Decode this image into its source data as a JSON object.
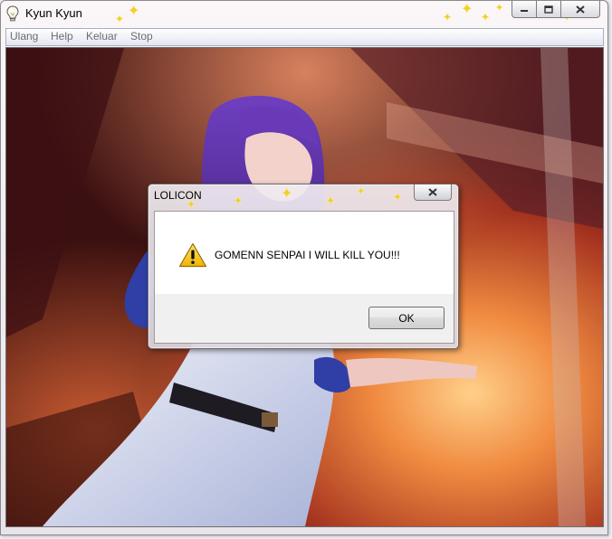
{
  "window": {
    "title": "Kyun Kyun",
    "icon": "lightbulb-icon",
    "controls": [
      "minimize-icon",
      "maximize-icon",
      "close-icon"
    ]
  },
  "menu": {
    "items": [
      {
        "label": "Ulang"
      },
      {
        "label": "Help"
      },
      {
        "label": "Keluar"
      },
      {
        "label": "Stop"
      }
    ]
  },
  "background": {
    "kind": "photo",
    "palette": {
      "smoke": "#e0622e",
      "dark": "#2a0d0e",
      "hair": "#5b2e9c",
      "dress": "#dfe4f3",
      "sleeve": "#2f3fa6"
    }
  },
  "dialog": {
    "title": "LOLICON",
    "message": "GOMENN SENPAI I WILL KILL YOU!!!",
    "icon": "warning-icon",
    "ok_label": "OK"
  }
}
